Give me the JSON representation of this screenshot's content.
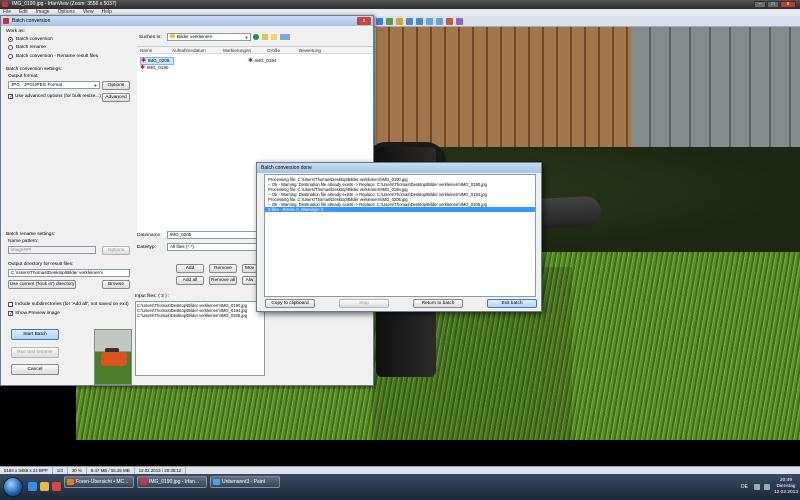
{
  "main_window": {
    "title": "IMG_0190.jpg - IrfanView (Zoom: 3556 x 5037)",
    "menu": [
      "File",
      "Edit",
      "Image",
      "Options",
      "View",
      "Help"
    ],
    "controls": {
      "minimize": "–",
      "maximize": "□",
      "close": "x"
    }
  },
  "batch": {
    "title": "Batch conversion",
    "work_as_label": "Work as:",
    "modes": [
      "Batch conversion",
      "Batch rename",
      "Batch conversion - Rename result files"
    ],
    "settings_label": "Batch conversion settings:",
    "output_format_label": "Output format:",
    "output_format_value": "JPG - JPG/JPEG Format",
    "options_button": "Options",
    "advanced_checkbox": "Use advanced options (for bulk resize...)",
    "advanced_button": "Advanced",
    "rename_settings_label": "Batch rename settings:",
    "name_pattern_label": "Name pattern:",
    "name_pattern_value": "image###",
    "rename_options_button": "Options",
    "output_dir_label": "Output directory for result files:",
    "output_dir_value": "C:\\Users\\Thomas\\Desktop\\Bilder verkleinern\\",
    "use_current_button": "Use current ('look in') directory",
    "browse_button": "Browse",
    "include_subdirs": "Include subdirectories (for 'Add all'; not saved on exit)",
    "show_preview": "Show Preview image",
    "start_button": "Start Batch",
    "test_rename_button": "Run test rename",
    "cancel_button": "Cancel",
    "look_in_label": "Suchen in:",
    "look_in_value": "Bilder verkleinern",
    "columns": [
      "Name",
      "Aufnahmedatum",
      "Markierungen",
      "Größe",
      "Bewertung"
    ],
    "files": [
      "IMG_0205",
      "IMG_0190",
      "IMG_0194"
    ],
    "filename_label": "Dateiname:",
    "filename_value": "IMG_0205",
    "filetype_label": "Dateityp:",
    "filetype_value": "All files (*.*)",
    "add_button": "Add",
    "remove_button": "Remove",
    "move_button": "Mov",
    "add_all_button": "Add all",
    "remove_all_button": "Remove all",
    "always_button": "Alw",
    "input_files_label": "Input files: ( 3 ) :",
    "input_files": [
      "C:\\Users\\Thomas\\Desktop\\Bilder verkleinern\\IMG_0190.jpg",
      "C:\\Users\\Thomas\\Desktop\\Bilder verkleinern\\IMG_0194.jpg",
      "C:\\Users\\Thomas\\Desktop\\Bilder verkleinern\\IMG_0205.jpg"
    ]
  },
  "done": {
    "title": "Batch conversion done",
    "log": [
      "Processing file: C:\\Users\\Thomas\\Desktop\\Bilder verkleinern\\IMG_0190.jpg",
      "-- Ok - Warning: Destination file already exists -> Replace: C:\\Users\\Thomas\\Desktop\\Bilder verkleinern\\IMG_0190.jpg",
      "Processing file: C:\\Users\\Thomas\\Desktop\\Bilder verkleinern\\IMG_0194.jpg",
      "-- Ok - Warning: Destination file already exists -> Replace: C:\\Users\\Thomas\\Desktop\\Bilder verkleinern\\IMG_0194.jpg",
      "Processing file: C:\\Users\\Thomas\\Desktop\\Bilder verkleinern\\IMG_0205.jpg",
      "-- Ok - Warning: Destination file already exists -> Replace: C:\\Users\\Thomas\\Desktop\\Bilder verkleinern\\IMG_0205.jpg"
    ],
    "summary": "3 files - Errors: 0, Warnings: 3",
    "copy_button": "Copy to clipboard",
    "stop_button": "Stop",
    "return_button": "Return to batch",
    "exit_button": "Exit batch"
  },
  "statusbar": [
    "5184 x 3456 x 24 BPP",
    "1/3",
    "30 %",
    "8.47 MB / 55.26 MB",
    "12.02.2013 / 20:35:12"
  ],
  "taskbar": {
    "tasks": [
      "Foren-Übersicht • MC...",
      "IMG_0190.jpg - Irfan...",
      "Unbenannt3 - Paint"
    ],
    "lang": "DE",
    "time": "20:49",
    "day": "Dienstag",
    "date": "12.02.2013"
  },
  "colors": {
    "selection": "#3399ff",
    "title_active": "#a6c4e6",
    "close": "#c23a2a"
  }
}
